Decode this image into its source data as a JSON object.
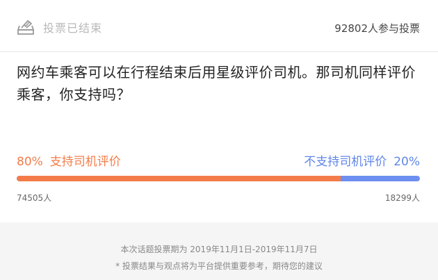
{
  "header": {
    "status_icon": "ballot-box-icon",
    "status_text": "投票已结束",
    "participants_text": "92802人参与投票"
  },
  "question": "网约车乘客可以在行程结束后用星级评价司机。那司机同样评价乘客，你支持吗？",
  "options": {
    "left": {
      "percent": "80%",
      "label": "支持司机评价",
      "count": "74505人",
      "color": "#f47c4a"
    },
    "right": {
      "percent": "20%",
      "label": "不支持司机评价",
      "count": "18299人",
      "color": "#5f86e8"
    }
  },
  "progress": {
    "left_fraction": 0.803
  },
  "footer": {
    "period": "本次话题投票期为 2019年11月1日-2019年11月7日",
    "note": "* 投票结果与观点将为平台提供重要参考，期待您的建议"
  }
}
